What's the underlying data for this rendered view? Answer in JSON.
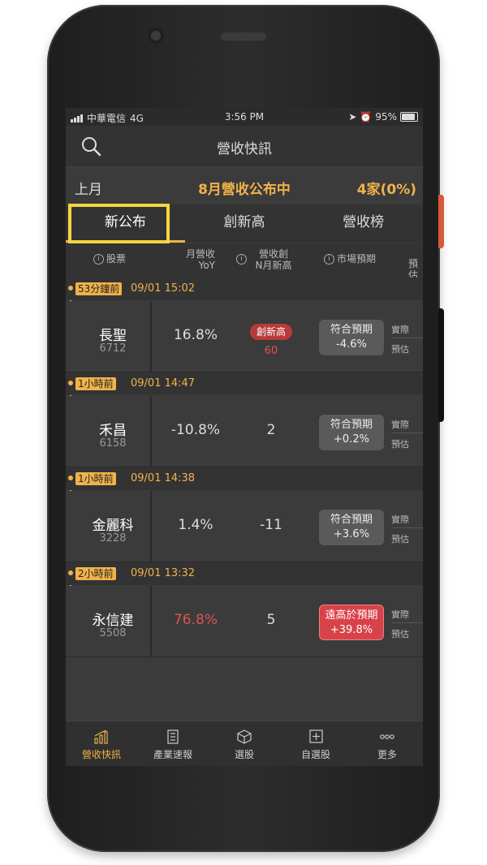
{
  "statusbar": {
    "carrier": "中華電信",
    "network": "4G",
    "time": "3:56 PM",
    "battery": "95%"
  },
  "navbar": {
    "title": "營收快訊"
  },
  "monthbar": {
    "prev": "上月",
    "center": "8月營收公布中",
    "count": "4家(0%)"
  },
  "tabs": [
    {
      "label": "新公布"
    },
    {
      "label": "創新高"
    },
    {
      "label": "營收榜"
    }
  ],
  "columns": {
    "stock": "股票",
    "yoy_line1": "月營收",
    "yoy_line2": "YoY",
    "nhigh_line1": "營收創",
    "nhigh_line2": "N月新高",
    "forecast": "市場預期",
    "extra": "預估"
  },
  "groups": [
    {
      "ago": "53分鐘前",
      "stamp": "09/01 15:02",
      "name": "長聖",
      "code": "6712",
      "yoy": "16.8%",
      "nhigh_badge": "創新高",
      "nhigh_value": "60",
      "expect_line1": "符合預期",
      "expect_line2": "-4.6%",
      "actual": "實際",
      "est": "預估"
    },
    {
      "ago": "1小時前",
      "stamp": "09/01 14:47",
      "name": "禾昌",
      "code": "6158",
      "yoy": "-10.8%",
      "nhigh_value": "2",
      "expect_line1": "符合預期",
      "expect_line2": "+0.2%",
      "actual": "實際",
      "est": "預估"
    },
    {
      "ago": "1小時前",
      "stamp": "09/01 14:38",
      "name": "金麗科",
      "code": "3228",
      "yoy": "1.4%",
      "nhigh_value": "-11",
      "expect_line1": "符合預期",
      "expect_line2": "+3.6%",
      "actual": "實際",
      "est": "預估"
    },
    {
      "ago": "2小時前",
      "stamp": "09/01 13:32",
      "name": "永信建",
      "code": "5508",
      "yoy": "76.8%",
      "nhigh_value": "5",
      "expect_line1": "遠高於預期",
      "expect_line2": "+39.8%",
      "actual": "實際",
      "est": "預估"
    }
  ],
  "tabbar": [
    {
      "label": "營收快訊"
    },
    {
      "label": "產業速報"
    },
    {
      "label": "選股"
    },
    {
      "label": "自選股"
    },
    {
      "label": "更多"
    }
  ],
  "colors": {
    "accent": "#f0b24a",
    "red": "#e05252",
    "highlight": "#f5d442"
  }
}
